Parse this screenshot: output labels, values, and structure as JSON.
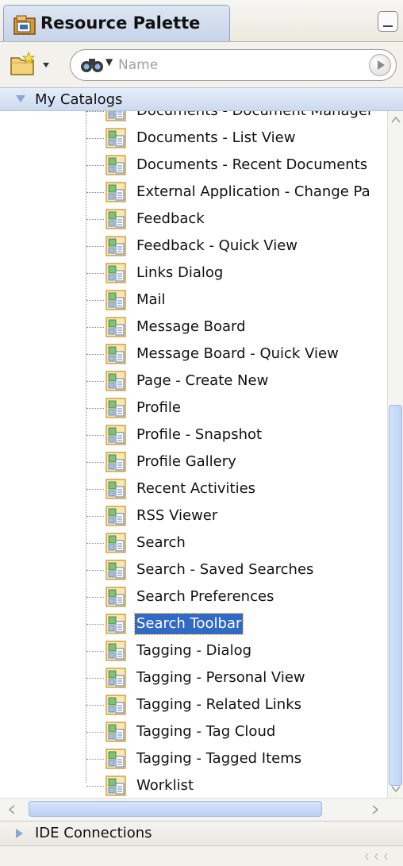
{
  "panel": {
    "title": "Resource Palette"
  },
  "toolbar": {
    "search_placeholder": "Name"
  },
  "sections": {
    "my_catalogs": "My Catalogs",
    "ide_connections": "IDE Connections"
  },
  "tree": {
    "items": [
      {
        "label": "Documents - Document Manager",
        "selected": false
      },
      {
        "label": "Documents - List View",
        "selected": false
      },
      {
        "label": "Documents - Recent Documents",
        "selected": false
      },
      {
        "label": "External Application - Change Pa",
        "selected": false
      },
      {
        "label": "Feedback",
        "selected": false
      },
      {
        "label": "Feedback - Quick View",
        "selected": false
      },
      {
        "label": "Links Dialog",
        "selected": false
      },
      {
        "label": "Mail",
        "selected": false
      },
      {
        "label": "Message Board",
        "selected": false
      },
      {
        "label": "Message Board - Quick View",
        "selected": false
      },
      {
        "label": "Page - Create New",
        "selected": false
      },
      {
        "label": "Profile",
        "selected": false
      },
      {
        "label": "Profile - Snapshot",
        "selected": false
      },
      {
        "label": "Profile Gallery",
        "selected": false
      },
      {
        "label": "Recent Activities",
        "selected": false
      },
      {
        "label": "RSS Viewer",
        "selected": false
      },
      {
        "label": "Search",
        "selected": false
      },
      {
        "label": "Search - Saved Searches",
        "selected": false
      },
      {
        "label": "Search Preferences",
        "selected": false
      },
      {
        "label": "Search Toolbar",
        "selected": true
      },
      {
        "label": "Tagging - Dialog",
        "selected": false
      },
      {
        "label": "Tagging - Personal View",
        "selected": false
      },
      {
        "label": "Tagging - Related Links",
        "selected": false
      },
      {
        "label": "Tagging - Tag Cloud",
        "selected": false
      },
      {
        "label": "Tagging - Tagged Items",
        "selected": false
      },
      {
        "label": "Worklist",
        "selected": false
      }
    ]
  },
  "colors": {
    "selection": "#3169c6",
    "header_blue": "#ccdaef"
  },
  "icons": {
    "tab": "resource-palette-icon",
    "new": "new-catalog-icon",
    "search": "binoculars-icon",
    "go": "go-arrow-icon",
    "item": "portlet-page-icon"
  }
}
